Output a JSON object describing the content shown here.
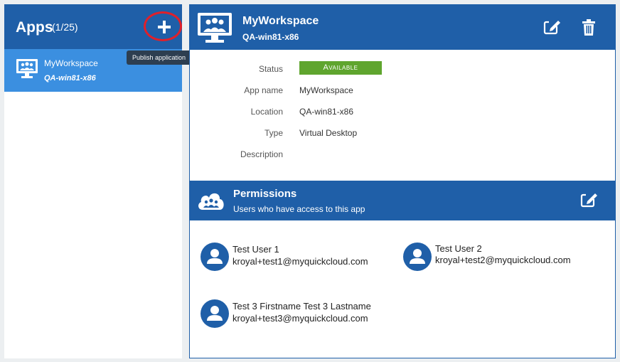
{
  "sidebar": {
    "title": "Apps",
    "count": "(1/25)",
    "add_tooltip": "Publish application",
    "items": [
      {
        "name": "MyWorkspace",
        "location": "QA-win81-x86"
      }
    ]
  },
  "app": {
    "name": "MyWorkspace",
    "location": "QA-win81-x86",
    "details": {
      "status_label": "Status",
      "status_value": "Available",
      "app_name_label": "App name",
      "app_name_value": "MyWorkspace",
      "location_label": "Location",
      "location_value": "QA-win81-x86",
      "type_label": "Type",
      "type_value": "Virtual Desktop",
      "description_label": "Description",
      "description_value": ""
    }
  },
  "permissions": {
    "title": "Permissions",
    "subtitle": "Users who have access to this app",
    "users": [
      {
        "name": "Test User 1",
        "email": "kroyal+test1@myquickcloud.com"
      },
      {
        "name": "Test User 2",
        "email": "kroyal+test2@myquickcloud.com"
      },
      {
        "name": "Test 3 Firstname Test 3 Lastname",
        "email": "kroyal+test3@myquickcloud.com"
      }
    ]
  },
  "colors": {
    "header_blue": "#1f5fa8",
    "selected_blue": "#3b8fe0",
    "status_green": "#5fa52e",
    "highlight_red": "#e0202a"
  },
  "icons": {
    "add": "plus-icon",
    "app": "monitor-users-icon",
    "edit": "edit-icon",
    "delete": "trash-icon",
    "permissions": "cloud-users-icon",
    "user": "user-avatar-icon"
  }
}
